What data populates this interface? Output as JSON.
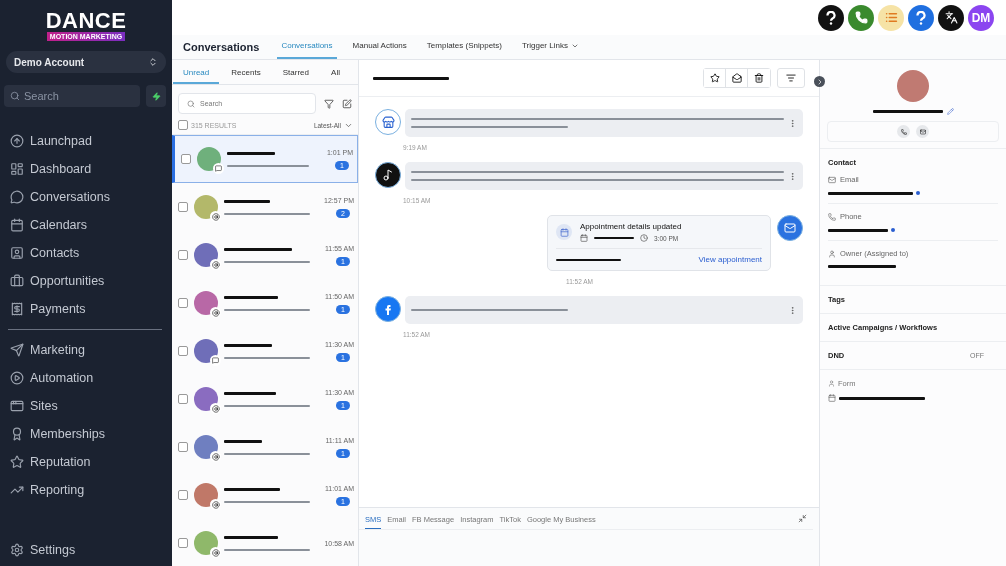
{
  "sidebar": {
    "logo": {
      "title": "DANCE",
      "tagline": "MOTION MARKETING"
    },
    "account": "Demo Account",
    "search": {
      "placeholder": "Search"
    },
    "groups": [
      [
        {
          "label": "Launchpad"
        },
        {
          "label": "Dashboard"
        },
        {
          "label": "Conversations"
        },
        {
          "label": "Calendars"
        },
        {
          "label": "Contacts"
        },
        {
          "label": "Opportunities"
        },
        {
          "label": "Payments"
        }
      ],
      [
        {
          "label": "Marketing"
        },
        {
          "label": "Automation"
        },
        {
          "label": "Sites"
        },
        {
          "label": "Memberships"
        },
        {
          "label": "Reputation"
        },
        {
          "label": "Reporting"
        }
      ]
    ],
    "footer": {
      "label": "Settings"
    }
  },
  "header": {
    "actions": [
      {
        "kind": "help",
        "color": "#111111"
      },
      {
        "kind": "phone",
        "color": "#3a8a2e"
      },
      {
        "kind": "list",
        "color": "#f6e3a6"
      },
      {
        "kind": "help",
        "color": "#1f6fe0"
      },
      {
        "kind": "translate",
        "color": "#111111"
      }
    ],
    "user": {
      "initials": "DM",
      "color": "#8b45f0"
    }
  },
  "page": {
    "title": "Conversations",
    "tabs": [
      {
        "label": "Conversations",
        "selected": true,
        "dropdown": false
      },
      {
        "label": "Manual Actions",
        "selected": false,
        "dropdown": false
      },
      {
        "label": "Templates (Snippets)",
        "selected": false,
        "dropdown": false
      },
      {
        "label": "Trigger Links",
        "selected": false,
        "dropdown": true
      }
    ]
  },
  "list": {
    "tabs": [
      {
        "label": "Unread",
        "selected": true
      },
      {
        "label": "Recents",
        "selected": false
      },
      {
        "label": "Starred",
        "selected": false
      },
      {
        "label": "All",
        "selected": false
      }
    ],
    "search": {
      "placeholder": "Search"
    },
    "select_all": {
      "checked": false
    },
    "results": "315 RESULTS",
    "sort": "Latest-All",
    "items": [
      {
        "color": "#6fb07c",
        "kind": "chat",
        "time": "1:01 PM",
        "count": "1",
        "selected": true,
        "checked": false
      },
      {
        "color": "#b3b86a",
        "kind": "email",
        "time": "12:57 PM",
        "count": "2",
        "selected": false,
        "checked": false
      },
      {
        "color": "#6f6eb8",
        "kind": "email",
        "time": "11:55 AM",
        "count": "1",
        "selected": false,
        "checked": false
      },
      {
        "color": "#b868a6",
        "kind": "email",
        "time": "11:50 AM",
        "count": "1",
        "selected": false,
        "checked": false
      },
      {
        "color": "#6f6eb8",
        "kind": "chat",
        "time": "11:30 AM",
        "count": "1",
        "selected": false,
        "checked": false
      },
      {
        "color": "#8a6cc0",
        "kind": "email",
        "time": "11:30 AM",
        "count": "1",
        "selected": false,
        "checked": false
      },
      {
        "color": "#6f7fc0",
        "kind": "email",
        "time": "11:11 AM",
        "count": "1",
        "selected": false,
        "checked": false
      },
      {
        "color": "#c07868",
        "kind": "email",
        "time": "11:01 AM",
        "count": "1",
        "selected": false,
        "checked": false
      },
      {
        "color": "#8fb86a",
        "kind": "email",
        "time": "10:58 AM",
        "selected": false,
        "checked": false
      }
    ]
  },
  "chat": {
    "messages": [
      {
        "kind": "store",
        "lines": [
          {
            "kind": "full"
          },
          {
            "kind": "partial"
          }
        ],
        "time": "9:19 AM"
      },
      {
        "kind": "tiktok",
        "lines": [
          {
            "kind": "full"
          },
          {
            "kind": "full"
          }
        ],
        "time": "10:15 AM"
      },
      {
        "kind": "appointment",
        "title": "Appointment details updated",
        "clock": "3:00 PM",
        "link": "View appointment",
        "time": "11:52 AM"
      },
      {
        "kind": "facebook",
        "lines": [
          {
            "kind": "partial"
          }
        ],
        "time": "11:52 AM"
      }
    ],
    "composer": {
      "tabs": [
        {
          "label": "SMS",
          "selected": true
        },
        {
          "label": "Email",
          "selected": false
        },
        {
          "label": "FB Message",
          "selected": false
        },
        {
          "label": "Instagram",
          "selected": false
        },
        {
          "label": "TikTok",
          "selected": false
        },
        {
          "label": "Google My Business",
          "selected": false
        }
      ]
    }
  },
  "contact": {
    "sections": [
      {
        "kind": "fields",
        "title": "Contact",
        "fields": [
          {
            "label": "Email"
          },
          {
            "label": "Phone"
          },
          {
            "label": "Owner (Assigned to)"
          }
        ]
      },
      {
        "kind": "heading",
        "title": "Tags"
      },
      {
        "kind": "heading",
        "title": "Active Campaigns / Workflows"
      },
      {
        "kind": "value",
        "title": "DND",
        "value": "OFF"
      },
      {
        "kind": "form",
        "title": "Form"
      }
    ]
  }
}
